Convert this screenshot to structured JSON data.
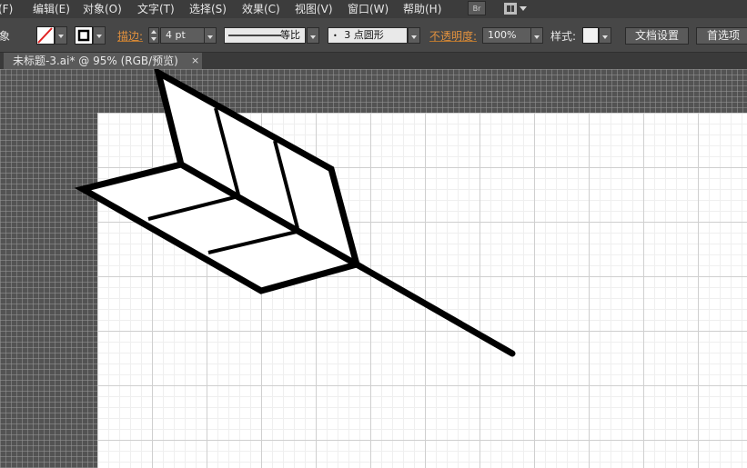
{
  "menubar": {
    "items": [
      "(F)",
      "编辑(E)",
      "对象(O)",
      "文字(T)",
      "选择(S)",
      "效果(C)",
      "视图(V)",
      "窗口(W)",
      "帮助(H)"
    ],
    "bridge_label": "Br"
  },
  "controlbar": {
    "panel_label": "象",
    "stroke_label": "描边:",
    "stroke_weight": "4 pt",
    "profile_label": "等比",
    "brush_label": "3 点圆形",
    "opacity_label": "不透明度:",
    "opacity_value": "100%",
    "style_label": "样式:",
    "doc_setup_button": "文档设置",
    "prefs_button": "首选项"
  },
  "document": {
    "tab_title": "未标题-3.ai* @ 95% (RGB/预览)",
    "close_glyph": "×"
  },
  "colors": {
    "fill_none_slash": "#e02020",
    "artwork_stroke": "#000000",
    "canvas_bg": "#535353",
    "artboard": "#ffffff",
    "orange_label": "#e2913e"
  }
}
